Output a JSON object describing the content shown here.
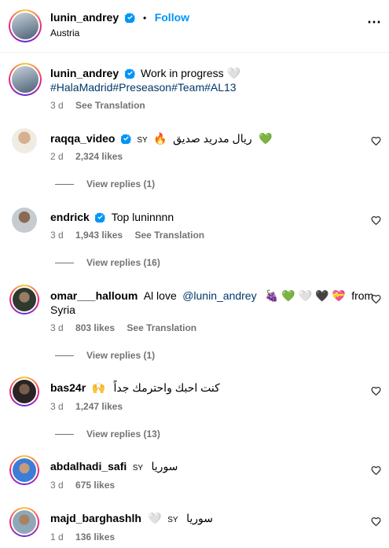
{
  "header": {
    "username": "lunin_andrey",
    "separator": "•",
    "follow": "Follow",
    "location": "Austria",
    "more": "⋯"
  },
  "caption": {
    "username": "lunin_andrey",
    "text": "Work in progress 🤍",
    "hashtags": "#HalaMadrid#Preseason#Team#AL13",
    "time": "3 d",
    "translation": "See Translation"
  },
  "comments": [
    {
      "username": "raqqa_video",
      "country": "SY",
      "emoji": "🔥",
      "text": "ريال مدريد صديق",
      "emoji2": "💚",
      "time": "2 d",
      "likes": "2,324 likes",
      "translation": "",
      "replies": "View replies (1)"
    },
    {
      "username": "endrick",
      "text": "Top luninnnn",
      "time": "3 d",
      "likes": "1,943 likes",
      "translation": "See Translation",
      "replies": "View replies (16)"
    },
    {
      "username": "omar___halloum",
      "text": "Al love",
      "mention": "@lunin_andrey",
      "emoji": "🍇 💚 🤍 🖤 💝",
      "text2": "from",
      "line2": "Syria",
      "time": "3 d",
      "likes": "803 likes",
      "translation": "See Translation",
      "replies": "View replies (1)"
    },
    {
      "username": "bas24r",
      "emoji": "🙌",
      "text": "كنت احبك واحترمك جداً",
      "time": "3 d",
      "likes": "1,247 likes",
      "translation": "",
      "replies": "View replies (13)"
    },
    {
      "username": "abdalhadi_safi",
      "country": "SY",
      "text": "سوريا",
      "time": "3 d",
      "likes": "675 likes",
      "translation": "",
      "replies": ""
    },
    {
      "username": "majd_barghashlh",
      "emoji": "🤍",
      "country": "SY",
      "text": "سوريا",
      "time": "1 d",
      "likes": "136 likes",
      "translation": "",
      "replies": ""
    }
  ],
  "colors": {
    "link": "#00376b",
    "follow": "#0095f6",
    "verified": "#0095f6",
    "meta": "#737373"
  }
}
